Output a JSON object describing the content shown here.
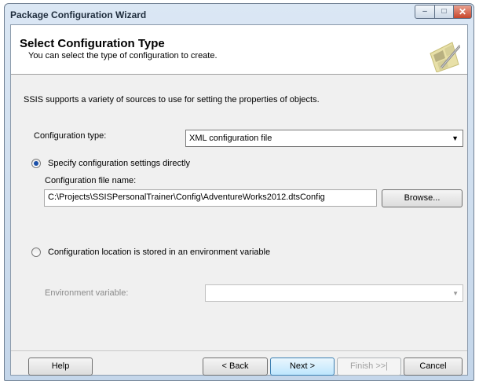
{
  "window": {
    "title": "Package Configuration Wizard",
    "controls": {
      "minimize": "–",
      "maximize": "□",
      "close": "✕"
    }
  },
  "header": {
    "title": "Select Configuration Type",
    "subtitle": "You can select the type of configuration to create.",
    "icon": "wizard-wand-icon"
  },
  "main": {
    "description": "SSIS supports a variety of sources to use for setting the properties of objects.",
    "config_type": {
      "label": "Configuration type:",
      "selected": "XML configuration file",
      "arrow": "▼"
    },
    "option_direct": {
      "label": "Specify configuration settings directly",
      "checked": true
    },
    "file_name": {
      "label": "Configuration file name:",
      "value": "C:\\Projects\\SSISPersonalTrainer\\Config\\AdventureWorks2012.dtsConfig",
      "browse_label": "Browse..."
    },
    "option_env": {
      "label": "Configuration location is stored in an environment variable",
      "checked": false
    },
    "env_variable": {
      "label": "Environment variable:",
      "value": "",
      "arrow": "▼"
    }
  },
  "footer": {
    "help": "Help",
    "back": "< Back",
    "next": "Next >",
    "finish": "Finish >>|",
    "cancel": "Cancel"
  }
}
